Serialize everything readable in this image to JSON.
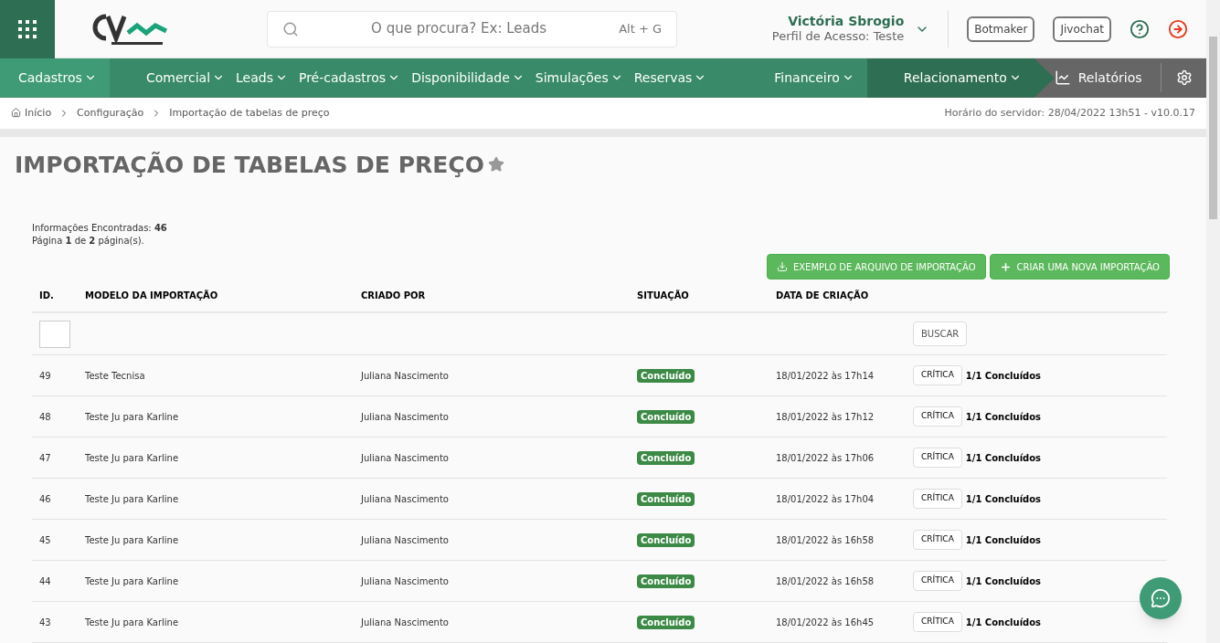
{
  "header": {
    "search": {
      "placeholder": "O que procura? Ex: Leads",
      "shortcut": "Alt + G"
    },
    "user": {
      "name": "Victória Sbrogio",
      "profile": "Perfil de Acesso: Teste"
    },
    "buttons": [
      "Botmaker",
      "Jivochat"
    ]
  },
  "nav": [
    {
      "color": "#3f9b76",
      "items": [
        "Cadastros"
      ]
    },
    {
      "color": "#388a68",
      "items": [
        "Comercial",
        "Leads",
        "Pré-cadastros",
        "Disponibilidade",
        "Simulações",
        "Reservas"
      ]
    },
    {
      "color": "#3a8a69",
      "items": [
        "Financeiro"
      ]
    },
    {
      "color": "#2e6e52",
      "items": [
        "Relacionamento"
      ]
    }
  ],
  "reports": "Relatórios",
  "breadcrumb": [
    "Início",
    "Configuração",
    "Importação de tabelas de preço"
  ],
  "server_time": "Horário do servidor: 28/04/2022 13h51 - v10.0.17",
  "title": "IMPORTAÇÃO DE TABELAS DE PREÇO",
  "info": [
    "Informações Encontradas: **46**",
    "Página **1** de **2** página(s)."
  ],
  "actions": [
    {
      "kind": "download",
      "label": "EXEMPLO DE ARQUIVO DE IMPORTAÇÃO"
    },
    {
      "kind": "add",
      "label": "CRIAR UMA NOVA IMPORTAÇÃO"
    }
  ],
  "table": {
    "columns": [
      "ID.",
      "MODELO DA IMPORTAÇÃO",
      "CRIADO POR",
      "SITUAÇÃO",
      "DATA DE CRIAÇÃO"
    ],
    "search_button": "BUSCAR",
    "rows": [
      {
        "id": "49",
        "model": "Teste Tecnisa",
        "creator": "Juliana Nascimento",
        "status": "Concluído",
        "date": "18/01/2022 às 17h14",
        "action": "CRÍTICA",
        "progress": "1/1 Concluídos"
      },
      {
        "id": "48",
        "model": "Teste Ju para Karline",
        "creator": "Juliana Nascimento",
        "status": "Concluído",
        "date": "18/01/2022 às 17h12",
        "action": "CRÍTICA",
        "progress": "1/1 Concluídos"
      },
      {
        "id": "47",
        "model": "Teste Ju para Karline",
        "creator": "Juliana Nascimento",
        "status": "Concluído",
        "date": "18/01/2022 às 17h06",
        "action": "CRÍTICA",
        "progress": "1/1 Concluídos"
      },
      {
        "id": "46",
        "model": "Teste Ju para Karline",
        "creator": "Juliana Nascimento",
        "status": "Concluído",
        "date": "18/01/2022 às 17h04",
        "action": "CRÍTICA",
        "progress": "1/1 Concluídos"
      },
      {
        "id": "45",
        "model": "Teste Ju para Karline",
        "creator": "Juliana Nascimento",
        "status": "Concluído",
        "date": "18/01/2022 às 16h58",
        "action": "CRÍTICA",
        "progress": "1/1 Concluídos"
      },
      {
        "id": "44",
        "model": "Teste Ju para Karline",
        "creator": "Juliana Nascimento",
        "status": "Concluído",
        "date": "18/01/2022 às 16h58",
        "action": "CRÍTICA",
        "progress": "1/1 Concluídos"
      },
      {
        "id": "43",
        "model": "Teste Ju para Karline",
        "creator": "Juliana Nascimento",
        "status": "Concluído",
        "date": "18/01/2022 às 16h45",
        "action": "CRÍTICA",
        "progress": "1/1 Concluídos"
      }
    ]
  }
}
